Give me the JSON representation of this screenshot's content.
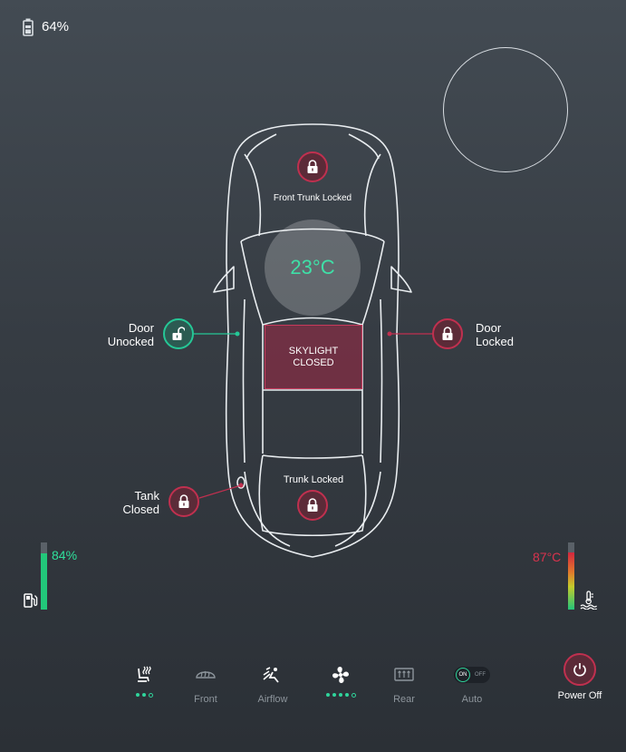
{
  "status": {
    "battery_percent": "64%"
  },
  "car": {
    "front_trunk_label": "Front Trunk Locked",
    "temperature": "23°C",
    "skylight_line1": "SKYLIGHT",
    "skylight_line2": "CLOSED",
    "trunk_label": "Trunk Locked",
    "left_door_line1": "Door",
    "left_door_line2": "Unocked",
    "right_door_line1": "Door",
    "right_door_line2": "Locked",
    "tank_line1": "Tank",
    "tank_line2": "Closed"
  },
  "gauges": {
    "fuel_label": "84%",
    "fuel_level": 0.84,
    "coolant_label": "87°C",
    "coolant_level": 0.85
  },
  "controls": {
    "front_label": "Front",
    "airflow_label": "Airflow",
    "rear_label": "Rear",
    "auto_label": "Auto",
    "toggle_on": "ON",
    "toggle_off": "OFF",
    "power_label": "Power Off"
  },
  "colors": {
    "accent_green": "#25c796",
    "alert_red": "#c0304f"
  }
}
